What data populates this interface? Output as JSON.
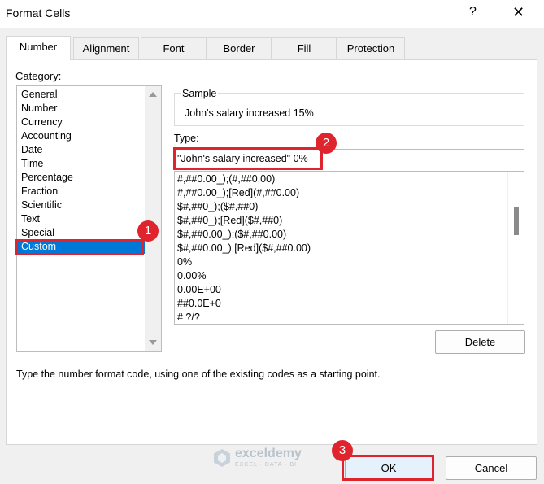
{
  "dialog": {
    "title": "Format Cells",
    "help_label": "?",
    "close_label": "✕"
  },
  "tabs": [
    {
      "label": "Number",
      "active": true
    },
    {
      "label": "Alignment"
    },
    {
      "label": "Font"
    },
    {
      "label": "Border"
    },
    {
      "label": "Fill"
    },
    {
      "label": "Protection"
    }
  ],
  "category": {
    "label": "Category:",
    "items": [
      "General",
      "Number",
      "Currency",
      "Accounting",
      "Date",
      "Time",
      "Percentage",
      "Fraction",
      "Scientific",
      "Text",
      "Special",
      "Custom"
    ],
    "selected": "Custom"
  },
  "sample": {
    "label": "Sample",
    "value": "John's salary increased 15%"
  },
  "type": {
    "label": "Type:",
    "value": "\"John's salary increased\" 0%"
  },
  "format_codes": [
    "#,##0.00_);(#,##0.00)",
    "#,##0.00_);[Red](#,##0.00)",
    "$#,##0_);($#,##0)",
    "$#,##0_);[Red]($#,##0)",
    "$#,##0.00_);($#,##0.00)",
    "$#,##0.00_);[Red]($#,##0.00)",
    "0%",
    "0.00%",
    "0.00E+00",
    "##0.0E+0",
    "# ?/?"
  ],
  "buttons": {
    "delete": "Delete",
    "ok": "OK",
    "cancel": "Cancel"
  },
  "hint": "Type the number format code, using one of the existing codes as a starting point.",
  "annotations": {
    "step1": "1",
    "step2": "2",
    "step3": "3"
  },
  "watermark": {
    "name": "exceldemy",
    "tagline": "EXCEL · DATA · BI"
  },
  "colors": {
    "accent": "#0078d7",
    "highlight": "#e0242d"
  }
}
